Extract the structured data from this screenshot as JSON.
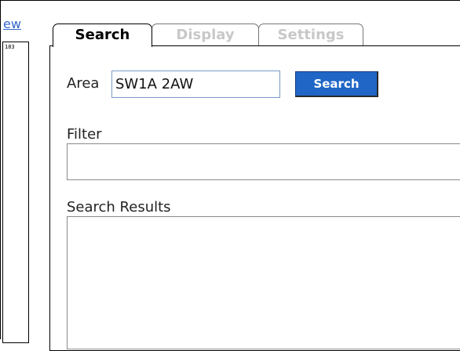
{
  "sidebar": {
    "view_link": "ew",
    "minimap_label": "183"
  },
  "tabs": [
    {
      "label": "Search",
      "active": true
    },
    {
      "label": "Display",
      "active": false
    },
    {
      "label": "Settings",
      "active": false
    }
  ],
  "search_form": {
    "area_label": "Area",
    "area_value": "SW1A 2AW",
    "search_button_label": "Search",
    "filter_label": "Filter",
    "filter_value": "",
    "results_label": "Search Results"
  },
  "colors": {
    "link": "#3366cc",
    "button": "#1f66c6",
    "inactive_tab_text": "#c8c8c8"
  }
}
